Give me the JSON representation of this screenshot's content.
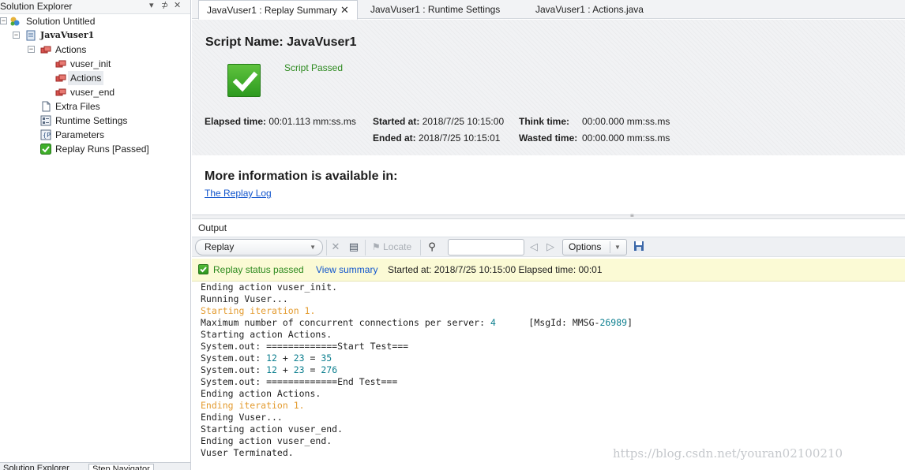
{
  "solution_explorer": {
    "title": "Solution Explorer",
    "controls": [
      "▾",
      "⊅",
      "✕"
    ],
    "tree": {
      "solution": "Solution Untitled",
      "script": "JavaVuser1",
      "actions_folder": "Actions",
      "actions": [
        "vuser_init",
        "Actions",
        "vuser_end"
      ],
      "extra_files": "Extra Files",
      "runtime_settings": "Runtime Settings",
      "parameters": "Parameters",
      "replay_runs": "Replay Runs [Passed]"
    },
    "bottom_tabs": [
      "Solution Explorer",
      "Step Navigator"
    ]
  },
  "tabs": [
    {
      "label": "JavaVuser1 : Replay Summary",
      "active": true
    },
    {
      "label": "JavaVuser1 : Runtime Settings",
      "active": false
    },
    {
      "label": "JavaVuser1 : Actions.java",
      "active": false
    }
  ],
  "summary": {
    "script_name_label": "Script Name:",
    "script_name": "JavaVuser1",
    "result": "Script Passed",
    "elapsed_label": "Elapsed time:",
    "elapsed_value": "00:01.113 mm:ss.ms",
    "started_label": "Started at:",
    "started_value": "2018/7/25 10:15:00",
    "ended_label": "Ended at:",
    "ended_value": "2018/7/25 10:15:01",
    "think_label": "Think time:",
    "think_value": "00:00.000 mm:ss.ms",
    "wasted_label": "Wasted time:",
    "wasted_value": "00:00.000 mm:ss.ms",
    "more_info": "More information is available in:",
    "replay_log_link": "The Replay Log"
  },
  "output": {
    "title": "Output",
    "source": "Replay",
    "locate": "Locate",
    "search_value": "",
    "options": "Options",
    "status": {
      "passed": "Replay status passed",
      "view_summary": "View summary",
      "details": "Started at: 2018/7/25 10:15:00 Elapsed time: 00:01"
    },
    "log": [
      {
        "text": "Ending action vuser_init.",
        "style": "normal"
      },
      {
        "text": "Running Vuser...",
        "style": "normal"
      },
      {
        "text": "Starting iteration 1.",
        "style": "orange"
      },
      {
        "text": "Maximum number of concurrent connections per server: 4      [MsgId: MMSG-26989]",
        "style": "normal"
      },
      {
        "text": "Starting action Actions.",
        "style": "normal"
      },
      {
        "text": "System.out: =============Start Test===",
        "style": "normal"
      },
      {
        "text": "System.out: 12 + 23 = 35",
        "style": "normal"
      },
      {
        "text": "System.out: 12 + 23 = 276",
        "style": "normal"
      },
      {
        "text": "System.out: =============End Test===",
        "style": "normal"
      },
      {
        "text": "Ending action Actions.",
        "style": "normal"
      },
      {
        "text": "Ending iteration 1.",
        "style": "orange"
      },
      {
        "text": "Ending Vuser...",
        "style": "normal"
      },
      {
        "text": "Starting action vuser_end.",
        "style": "normal"
      },
      {
        "text": "Ending action vuser_end.",
        "style": "normal"
      },
      {
        "text": "Vuser Terminated.",
        "style": "normal"
      }
    ]
  },
  "watermark": "https://blog.csdn.net/youran02100210",
  "colors": {
    "passed_green": "#2d8a1f",
    "link_blue": "#1155cc",
    "log_orange": "#e39b2f",
    "log_number": "#0d7f8f",
    "status_bar_bg": "#fbfad5"
  }
}
